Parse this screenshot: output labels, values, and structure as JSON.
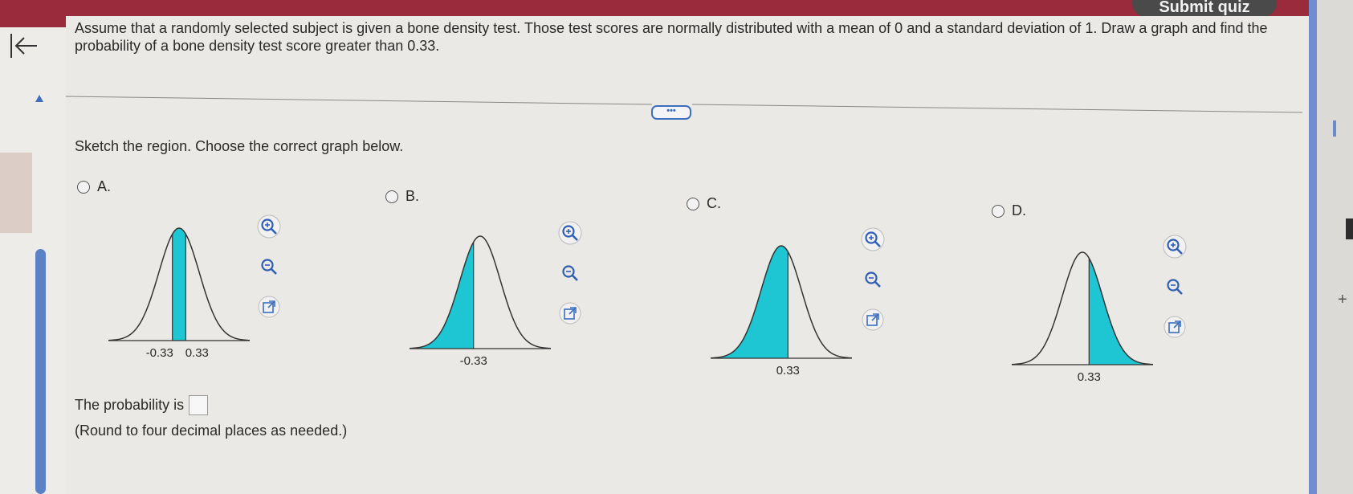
{
  "header": {
    "submit_label": "Submit quiz"
  },
  "question": {
    "text": "Assume that a randomly selected subject is given a bone density test. Those test scores are normally distributed with a mean of 0 and a standard deviation of 1. Draw a graph and find the probability of a bone density test score greater than 0.33.",
    "more_label": "•••"
  },
  "prompt": {
    "sketch": "Sketch the region. Choose the correct graph below."
  },
  "options": [
    {
      "label": "A.",
      "shade": "between",
      "ticks": [
        "-0.33",
        "0.33"
      ],
      "selected": false
    },
    {
      "label": "B.",
      "shade": "left",
      "ticks": [
        "-0.33"
      ],
      "selected": false
    },
    {
      "label": "C.",
      "shade": "left",
      "ticks": [
        "0.33"
      ],
      "selected": false
    },
    {
      "label": "D.",
      "shade": "right",
      "ticks": [
        "0.33"
      ],
      "selected": false
    }
  ],
  "tools": {
    "zoom_in": "zoom-in-icon",
    "zoom_out": "zoom-out-icon",
    "popout": "external-link-icon"
  },
  "answer": {
    "label": "The probability is",
    "value": "",
    "note": "(Round to four decimal places as needed.)"
  },
  "colors": {
    "shade": "#1ec6d4",
    "accent": "#3d6fbf",
    "header": "#9a2b3d"
  }
}
